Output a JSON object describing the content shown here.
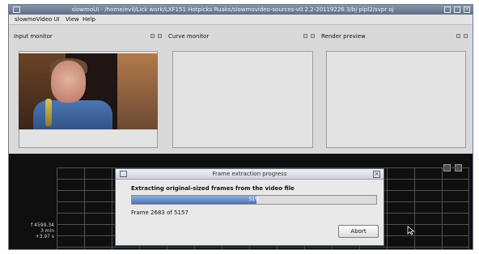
{
  "window": {
    "title": "slowmoUI - /home/evil/Lick work/LXF151 Hotpicks Ruaks/slowmovideo-sources-v0.2.2-20119226.3/bj plpl2/svpr oj"
  },
  "menu": {
    "items": [
      "slowmoVideo UI",
      "View",
      "Help"
    ]
  },
  "monitors": {
    "input_label": "Input monitor",
    "curve_label": "Curve monitor",
    "render_label": "Render preview"
  },
  "timeline": {
    "readout": [
      "f 4599.34",
      "3 min",
      "+3.97 s"
    ]
  },
  "dialog": {
    "title": "Frame extraction progress",
    "heading": "Extracting original-sized frames from the video file",
    "progress_percent": 51,
    "progress_text": "51%",
    "status": "Frame 2683 of 5157",
    "abort_label": "Abort"
  },
  "icons": {
    "window_icon": "window-icon",
    "close": "close-icon",
    "dock": "dock-icon",
    "cursor": "mouse-cursor-icon"
  },
  "colors": {
    "titlebar": "#6f7f96",
    "progress": "#4a74b4",
    "timeline_bg": "#0f0f0f"
  }
}
